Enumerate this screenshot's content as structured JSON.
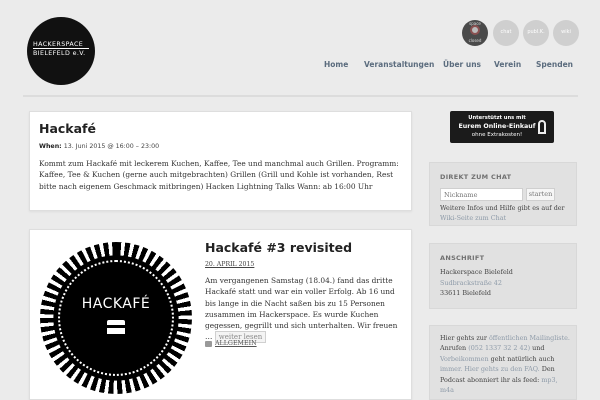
{
  "header": {
    "logo_line1": "HACKERSPACE",
    "logo_line2": "BIELEFELD e.V.",
    "status_top": "space",
    "status_bottom": "closed",
    "round_buttons": [
      "chat",
      "publ.K.",
      "wiki"
    ],
    "nav": [
      "Home",
      "Veranstaltungen",
      "Über uns",
      "Verein",
      "Spenden"
    ]
  },
  "post1": {
    "title": "Hackafé",
    "meta_label": "When:",
    "meta_value": "13. Juni 2015 @ 16:00 – 23:00",
    "body": "Kommt zum Hackafé mit leckerem Kuchen, Kaffee, Tee und manchmal auch Grillen. Programm: Kaffee, Tee & Kuchen (gerne auch mitgebrachten) Grillen (Grill und Kohle ist vorhanden, Rest bitte nach eigenem Geschmack mitbringen) Hacken Lightning Talks Wann: ab 16:00 Uhr"
  },
  "post2": {
    "image_word": "HACKAFÉ",
    "title": "Hackafé #3 revisited",
    "date": "20. APRIL 2015",
    "body": "Am vergangenen Samstag (18.04.) fand das dritte Hackafé statt und war ein voller Erfolg. Ab 16 und bis lange in die Nacht saßen bis zu 15 Personen zusammen im Hackerspace. Es wurde Kuchen gegessen, gegrillt und sich unterhalten. Wir freuen …",
    "more": "weiter lesen",
    "category": "ALLGEMEIN"
  },
  "sidebar": {
    "donate_l1": "Unterstützt uns mit",
    "donate_l2": "Eurem Online-Einkauf",
    "donate_l3": "ohne Extrakosten!",
    "chat_title": "DIREKT ZUM CHAT",
    "chat_placeholder": "Nickname",
    "chat_button": "starten",
    "chat_text": "Weitere Infos und Hilfe gibt es auf der",
    "chat_link": "Wiki-Seite zum Chat",
    "addr_title": "ANSCHRIFT",
    "addr_name": "Hackerspace Bielefeld",
    "addr_street": "Sudbrackstraße 42",
    "addr_city": "33611 Bielefeld",
    "info_1": "Hier gehts zur",
    "info_link1": "öffentlichen Mailingliste.",
    "info_2": "Anrufen",
    "info_link2": "(052 1337 32 2 42)",
    "info_3": "und",
    "info_link3": "Vorbeikommen",
    "info_4": "geht natürlich auch",
    "info_link4": "immer. Hier gehts zu den FAQ.",
    "info_5": "Den Podcast abonniert ihr als feed:",
    "info_link5": "mp3, m4a"
  }
}
